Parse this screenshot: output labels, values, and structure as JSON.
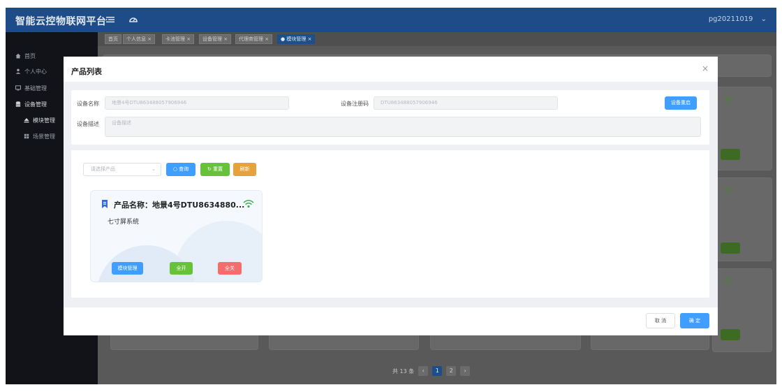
{
  "header": {
    "app_title": "智能云控物联网平台",
    "user": "pg20211019"
  },
  "sidebar": {
    "items": [
      {
        "label": "首页",
        "icon": "home-icon"
      },
      {
        "label": "个人中心",
        "icon": "user-icon"
      },
      {
        "label": "基础管理",
        "icon": "monitor-icon"
      },
      {
        "label": "设备管理",
        "icon": "database-icon"
      },
      {
        "label": "模块管理",
        "icon": "eject-icon"
      },
      {
        "label": "场景管理",
        "icon": "grid-icon"
      }
    ]
  },
  "tabs": [
    {
      "label": "首页"
    },
    {
      "label": "个人信息"
    },
    {
      "label": "卡池管理"
    },
    {
      "label": "设备管理"
    },
    {
      "label": "代理商管理"
    },
    {
      "label": "模块管理"
    }
  ],
  "pagination": {
    "total": "共 13 条",
    "pages": [
      "1",
      "2"
    ],
    "current": "1"
  },
  "modal": {
    "title": "产品列表",
    "form": {
      "device_name_label": "设备名称",
      "device_name_value": "地景4号DTU863488057906946",
      "reg_code_label": "设备注册码",
      "reg_code_value": "DTU863488057906946",
      "restart_label": "设备重启",
      "desc_label": "设备描述",
      "desc_placeholder": "设备描述"
    },
    "filter": {
      "select_placeholder": "请选择产品",
      "query_label": "查询",
      "reset_label": "重置",
      "refresh_label": "刷新"
    },
    "product": {
      "name": "产品名称：地景4号DTU8634880...",
      "desc": "七寸屏系统",
      "module_btn": "模块管理",
      "on_btn": "全开",
      "off_btn": "全关"
    },
    "footer": {
      "cancel": "取 消",
      "confirm": "确 定"
    }
  },
  "colors": {
    "header": "#1e4c88",
    "primary": "#409eff",
    "success": "#67c23a",
    "warning": "#e6a23c",
    "danger": "#f56c6c"
  }
}
